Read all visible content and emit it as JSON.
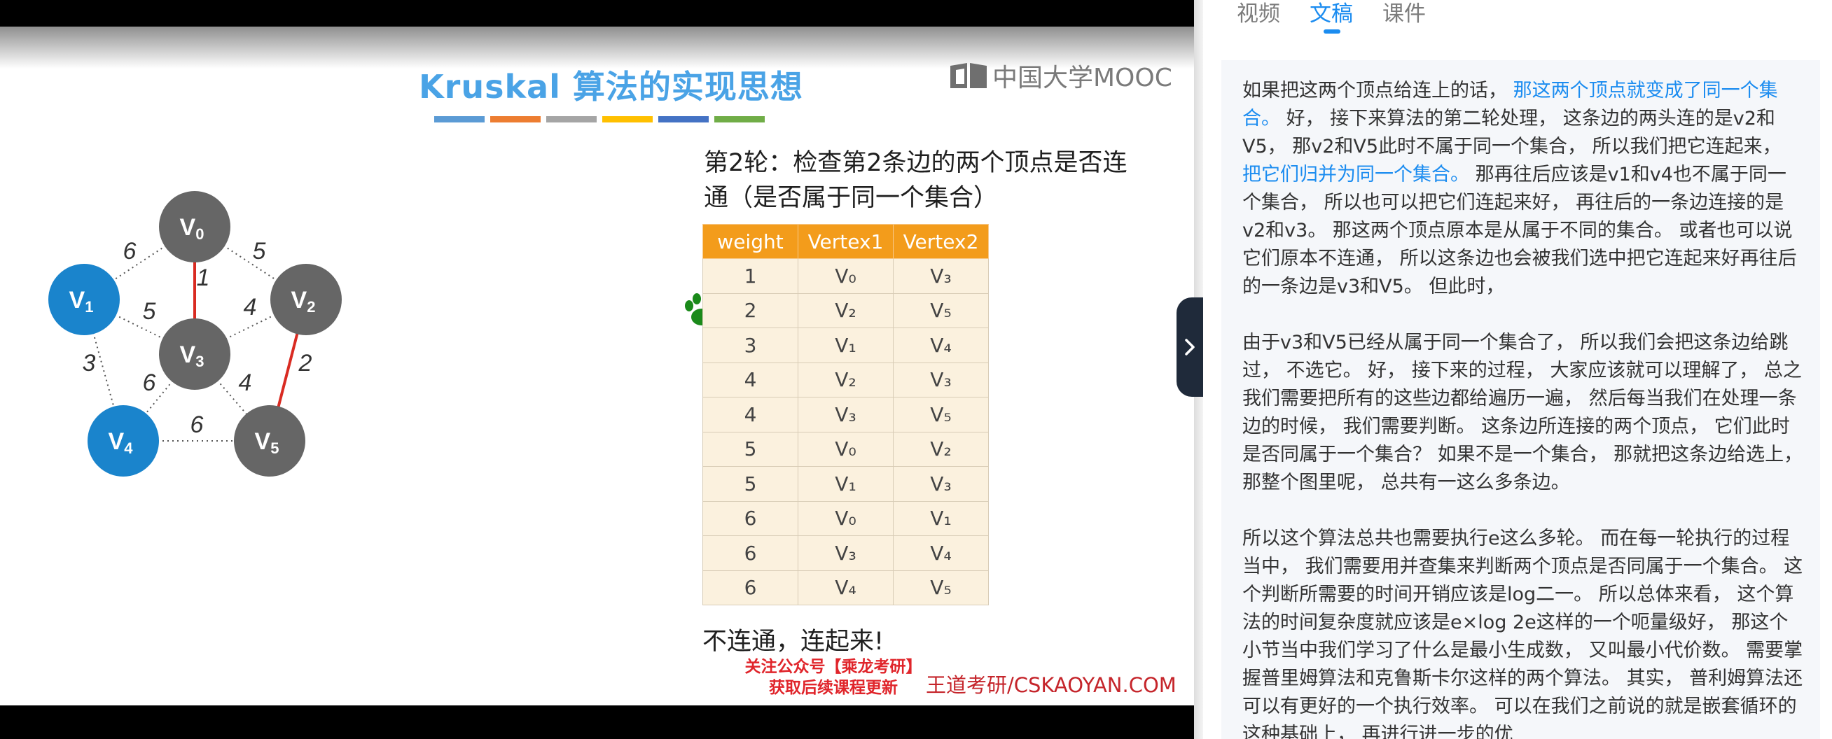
{
  "slide": {
    "title": "Kruskal 算法的实现思想",
    "title_bar_colors": [
      "#5b9bd5",
      "#ed7d31",
      "#a5a5a5",
      "#ffc000",
      "#4472c4",
      "#70ad47"
    ],
    "logo_text": "中国大学MOOC",
    "round_text": "第2轮：检查第2条边的两个顶点是否连通（是否属于同一个集合）",
    "connect_text": "不连通，连起来!",
    "promo_line1": "关注公众号【乘龙考研】",
    "promo_line2": "获取后续课程更新",
    "watermark": "王道考研/CSKAOYAN.COM",
    "graph": {
      "nodes": [
        {
          "id": "v0",
          "label": "V",
          "sub": "0",
          "color": "#666666"
        },
        {
          "id": "v1",
          "label": "V",
          "sub": "1",
          "color": "#1a84cc"
        },
        {
          "id": "v2",
          "label": "V",
          "sub": "2",
          "color": "#666666"
        },
        {
          "id": "v3",
          "label": "V",
          "sub": "3",
          "color": "#666666"
        },
        {
          "id": "v4",
          "label": "V",
          "sub": "4",
          "color": "#1a84cc"
        },
        {
          "id": "v5",
          "label": "V",
          "sub": "5",
          "color": "#666666"
        }
      ],
      "edges": [
        {
          "from": "v0",
          "to": "v1",
          "weight": "6",
          "selected": false
        },
        {
          "from": "v0",
          "to": "v2",
          "weight": "5",
          "selected": false
        },
        {
          "from": "v0",
          "to": "v3",
          "weight": "1",
          "selected": true
        },
        {
          "from": "v1",
          "to": "v3",
          "weight": "5",
          "selected": false
        },
        {
          "from": "v1",
          "to": "v4",
          "weight": "3",
          "selected": false
        },
        {
          "from": "v2",
          "to": "v3",
          "weight": "4",
          "selected": false
        },
        {
          "from": "v2",
          "to": "v5",
          "weight": "2",
          "selected": true
        },
        {
          "from": "v3",
          "to": "v4",
          "weight": "6",
          "selected": false
        },
        {
          "from": "v3",
          "to": "v5",
          "weight": "4",
          "selected": false
        },
        {
          "from": "v4",
          "to": "v5",
          "weight": "6",
          "selected": false
        }
      ]
    },
    "table": {
      "headers": [
        "weight",
        "Vertex1",
        "Vertex2"
      ],
      "rows": [
        [
          "1",
          "V₀",
          "V₃"
        ],
        [
          "2",
          "V₂",
          "V₅"
        ],
        [
          "3",
          "V₁",
          "V₄"
        ],
        [
          "4",
          "V₂",
          "V₃"
        ],
        [
          "4",
          "V₃",
          "V₅"
        ],
        [
          "5",
          "V₀",
          "V₂"
        ],
        [
          "5",
          "V₁",
          "V₃"
        ],
        [
          "6",
          "V₀",
          "V₁"
        ],
        [
          "6",
          "V₃",
          "V₄"
        ],
        [
          "6",
          "V₄",
          "V₅"
        ]
      ]
    }
  },
  "panel": {
    "tabs": [
      "视频",
      "文稿",
      "课件"
    ],
    "active_tab": "文稿",
    "transcript": [
      [
        {
          "text": "如果把这两个顶点给连上的话， ",
          "hl": false
        },
        {
          "text": "那这两个顶点就变成了同一个集合。",
          "hl": true
        },
        {
          "text": " 好， 接下来算法的第二轮处理， 这条边的两头连的是v2和V5， 那v2和V5此时不属于同一个集合， 所以我们把它连起来， ",
          "hl": false
        },
        {
          "text": "把它们归并为同一个集合。",
          "hl": true
        },
        {
          "text": " 那再往后应该是v1和v4也不属于同一个集合， 所以也可以把它们连起来好， 再往后的一条边连接的是v2和v3。 那这两个顶点原本是从属于不同的集合。 或者也可以说它们原本不连通， 所以这条边也会被我们选中把它连起来好再往后的一条边是v3和V5。 但此时，",
          "hl": false
        }
      ],
      [
        {
          "text": "由于v3和V5已经从属于同一个集合了， 所以我们会把这条边给跳过， 不选它。 好， 接下来的过程， 大家应该就可以理解了， 总之我们需要把所有的这些边都给遍历一遍， 然后每当我们在处理一条边的时候， 我们需要判断。 这条边所连接的两个顶点， 它们此时是否同属于一个集合？ 如果不是一个集合， 那就把这条边给选上， 那整个图里呢， 总共有一这么多条边。",
          "hl": false
        }
      ],
      [
        {
          "text": "所以这个算法总共也需要执行e这么多轮。 而在每一轮执行的过程当中， 我们需要用并查集来判断两个顶点是否同属于一个集合。 这个判断所需要的时间开销应该是log二一。 所以总体来看， 这个算法的时间复杂度就应该是e×log 2e这样的一个呃量级好， 那这个小节当中我们学习了什么是最小生成数， 又叫最小代价数。 需要掌握普里姆算法和克鲁斯卡尔这样的两个算法。 其实， 普利姆算法还可以有更好的一个执行效率。 可以在我们之前说的就是嵌套循环的这种基础上， 再进行进一步的优",
          "hl": false
        }
      ]
    ]
  }
}
